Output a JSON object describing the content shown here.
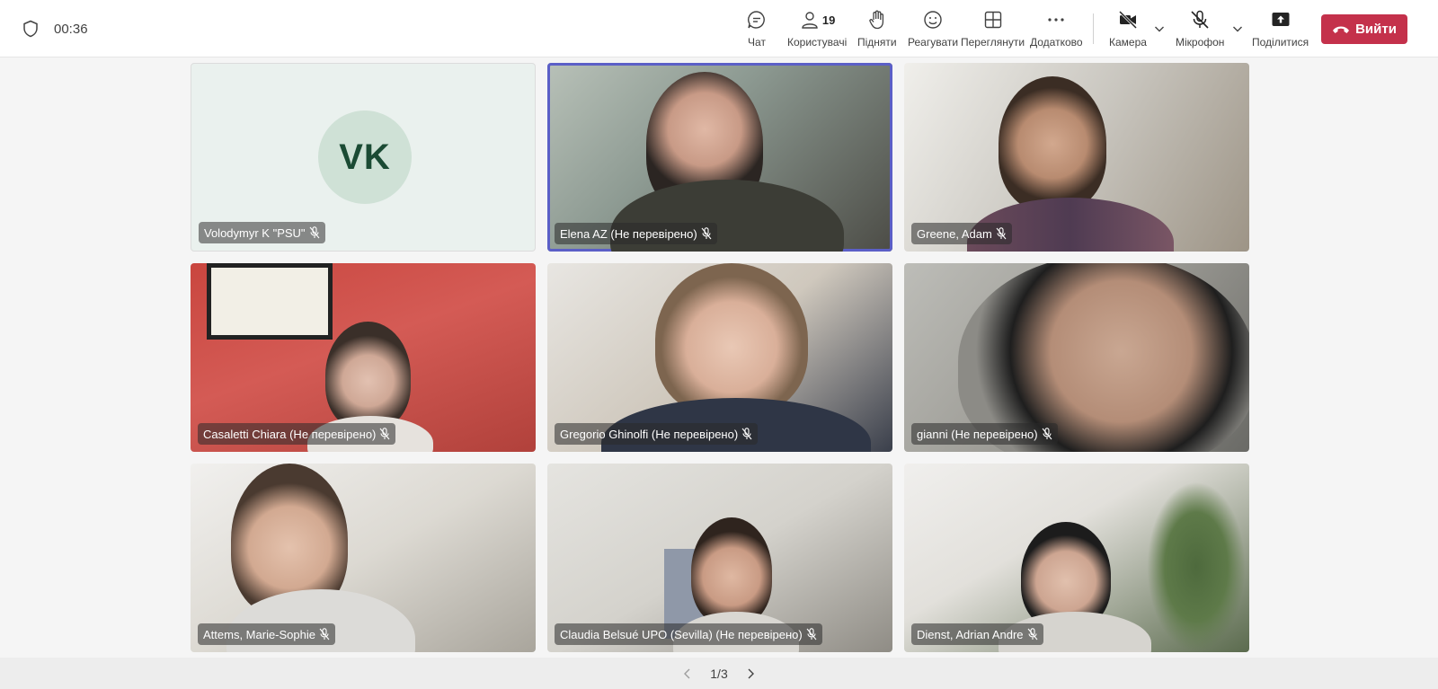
{
  "header": {
    "timer": "00:36",
    "tools": [
      {
        "label": "Чат",
        "icon": "chat-icon"
      },
      {
        "label": "Користувачі",
        "icon": "people-icon",
        "count": "19"
      },
      {
        "label": "Підняти",
        "icon": "raise-hand-icon"
      },
      {
        "label": "Реагувати",
        "icon": "react-icon"
      },
      {
        "label": "Переглянути",
        "icon": "view-icon"
      },
      {
        "label": "Додатково",
        "icon": "more-icon"
      },
      {
        "label": "Камера",
        "icon": "camera-off-icon"
      },
      {
        "label": "Мікрофон",
        "icon": "mic-off-icon"
      },
      {
        "label": "Поділитися",
        "icon": "share-icon"
      }
    ],
    "leave_label": "Вийти",
    "accent": "#5b5fc7",
    "leave_color": "#c4314b"
  },
  "participants": [
    {
      "name": "Volodymyr K \"PSU\"",
      "initials": "VK",
      "muted": true,
      "video": false
    },
    {
      "name": "Elena AZ (Не перевірено)",
      "muted": true,
      "video": true,
      "active": true
    },
    {
      "name": "Greene, Adam",
      "muted": true,
      "video": true
    },
    {
      "name": "Casaletti Chiara (Не перевірено)",
      "muted": true,
      "video": true
    },
    {
      "name": "Gregorio Ghinolfi (Не перевірено)",
      "muted": true,
      "video": true
    },
    {
      "name": "gianni (Не перевірено)",
      "muted": true,
      "video": true
    },
    {
      "name": "Attems, Marie-Sophie",
      "muted": true,
      "video": true
    },
    {
      "name": "Claudia Belsué UPO (Sevilla) (Не перевірено)",
      "muted": true,
      "video": true
    },
    {
      "name": "Dienst, Adrian Andre",
      "muted": true,
      "video": true
    }
  ],
  "pager": {
    "label": "1/3"
  }
}
